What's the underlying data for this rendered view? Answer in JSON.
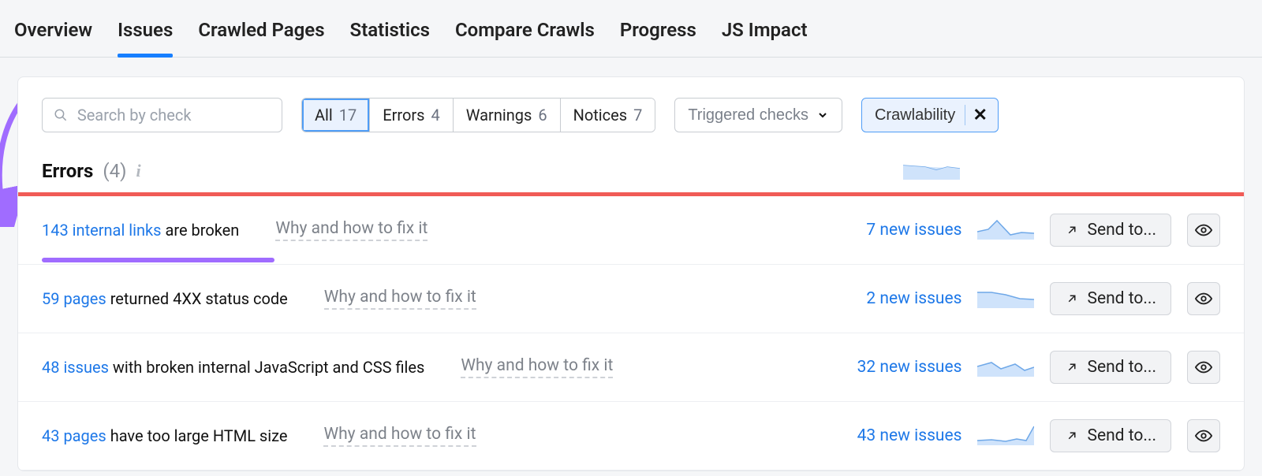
{
  "tabs": [
    "Overview",
    "Issues",
    "Crawled Pages",
    "Statistics",
    "Compare Crawls",
    "Progress",
    "JS Impact"
  ],
  "active_tab_index": 1,
  "toolbar": {
    "search_placeholder": "Search by check",
    "filters": [
      {
        "label": "All",
        "count": 17,
        "active": true
      },
      {
        "label": "Errors",
        "count": 4,
        "active": false
      },
      {
        "label": "Warnings",
        "count": 6,
        "active": false
      },
      {
        "label": "Notices",
        "count": 7,
        "active": false
      }
    ],
    "triggered_label": "Triggered checks",
    "tag_label": "Crawlability"
  },
  "section": {
    "title": "Errors",
    "count_text": "(4)"
  },
  "fix_label": "Why and how to fix it",
  "send_label": "Send to...",
  "rows": [
    {
      "link": "143 internal links",
      "rest": "are broken",
      "new": "7 new issues"
    },
    {
      "link": "59 pages",
      "rest": "returned 4XX status code",
      "new": "2 new issues"
    },
    {
      "link": "48 issues",
      "rest": "with broken internal JavaScript and CSS files",
      "new": "32 new issues"
    },
    {
      "link": "43 pages",
      "rest": "have too large HTML size",
      "new": "43 new issues"
    }
  ]
}
